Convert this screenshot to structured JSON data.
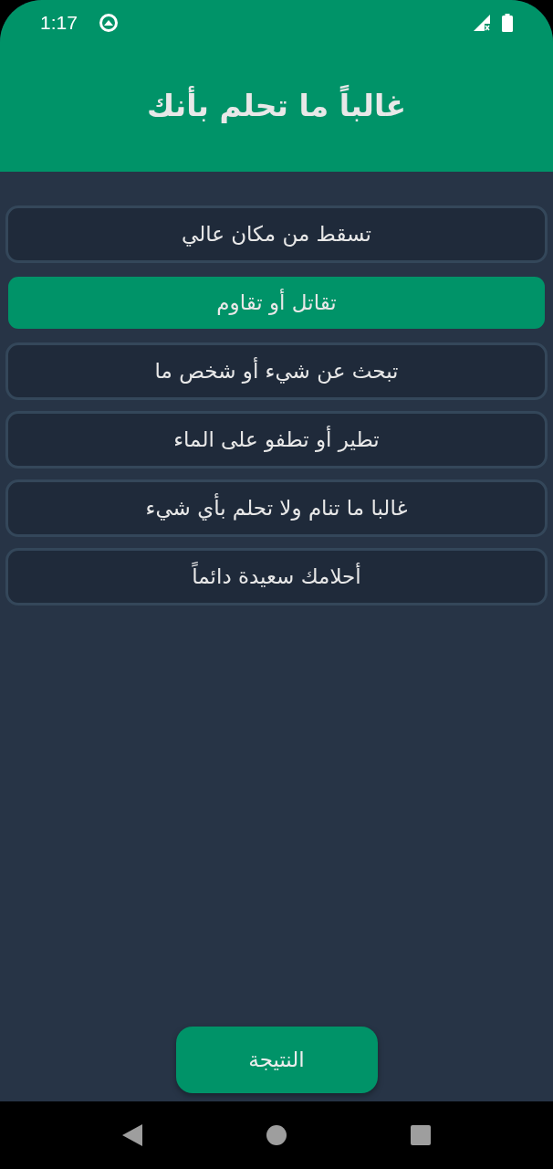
{
  "status_bar": {
    "time": "1:17"
  },
  "header": {
    "title": "غالباً ما تحلم بأنك"
  },
  "options": [
    {
      "label": "تسقط من مكان عالي",
      "selected": false
    },
    {
      "label": "تقاتل أو تقاوم",
      "selected": true
    },
    {
      "label": "تبحث عن شيء أو شخص ما",
      "selected": false
    },
    {
      "label": "تطير أو تطفو على الماء",
      "selected": false
    },
    {
      "label": "غالبا ما تنام ولا تحلم بأي شيء",
      "selected": false
    },
    {
      "label": "أحلامك سعيدة دائماً",
      "selected": false
    }
  ],
  "result_button": {
    "label": "النتيجة"
  }
}
